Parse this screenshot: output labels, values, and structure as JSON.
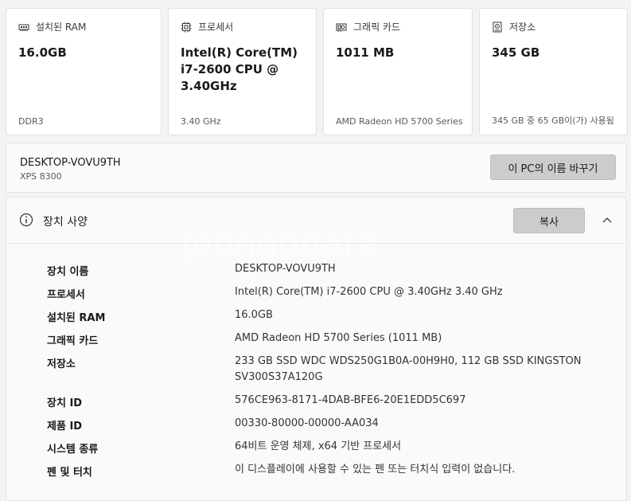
{
  "cards": [
    {
      "icon": "memory-icon",
      "label": "설치된 RAM",
      "value": "16.0GB",
      "sub": "DDR3"
    },
    {
      "icon": "cpu-icon",
      "label": "프로세서",
      "value": "Intel(R) Core(TM)\ni7-2600 CPU @\n3.40GHz",
      "sub": "3.40 GHz"
    },
    {
      "icon": "gpu-icon",
      "label": "그래픽 카드",
      "value": "1011 MB",
      "sub": "AMD Radeon HD 5700 Series"
    },
    {
      "icon": "storage-icon",
      "label": "저장소",
      "value": "345 GB",
      "sub": "345 GB 중 65 GB이(가) 사용됨"
    }
  ],
  "device": {
    "name": "DESKTOP-VOVU9TH",
    "model": "XPS 8300",
    "rename_label": "이 PC의 이름 바꾸기"
  },
  "specs": {
    "title": "장치 사양",
    "copy_label": "복사",
    "watermark": "Joongonara",
    "rows": [
      {
        "label": "장치 이름",
        "value": "DESKTOP-VOVU9TH"
      },
      {
        "label": "프로세서",
        "value": "Intel(R) Core(TM) i7-2600 CPU @ 3.40GHz   3.40 GHz"
      },
      {
        "label": "설치된 RAM",
        "value": "16.0GB"
      },
      {
        "label": "그래픽 카드",
        "value": "AMD Radeon HD 5700 Series (1011 MB)"
      },
      {
        "label": "저장소",
        "value": "233 GB SSD WDC WDS250G1B0A-00H9H0, 112 GB SSD KINGSTON\nSV300S37A120G"
      },
      {
        "label": "장치 ID",
        "value": "576CE963-8171-4DAB-BFE6-20E1EDD5C697"
      },
      {
        "label": "제품 ID",
        "value": "00330-80000-00000-AA034"
      },
      {
        "label": "시스템 종류",
        "value": "64비트 운영 체제, x64 기반 프로세서"
      },
      {
        "label": "펜 및 터치",
        "value": "이 디스플레이에 사용할 수 있는 펜 또는 터치식 입력이 없습니다."
      }
    ]
  }
}
